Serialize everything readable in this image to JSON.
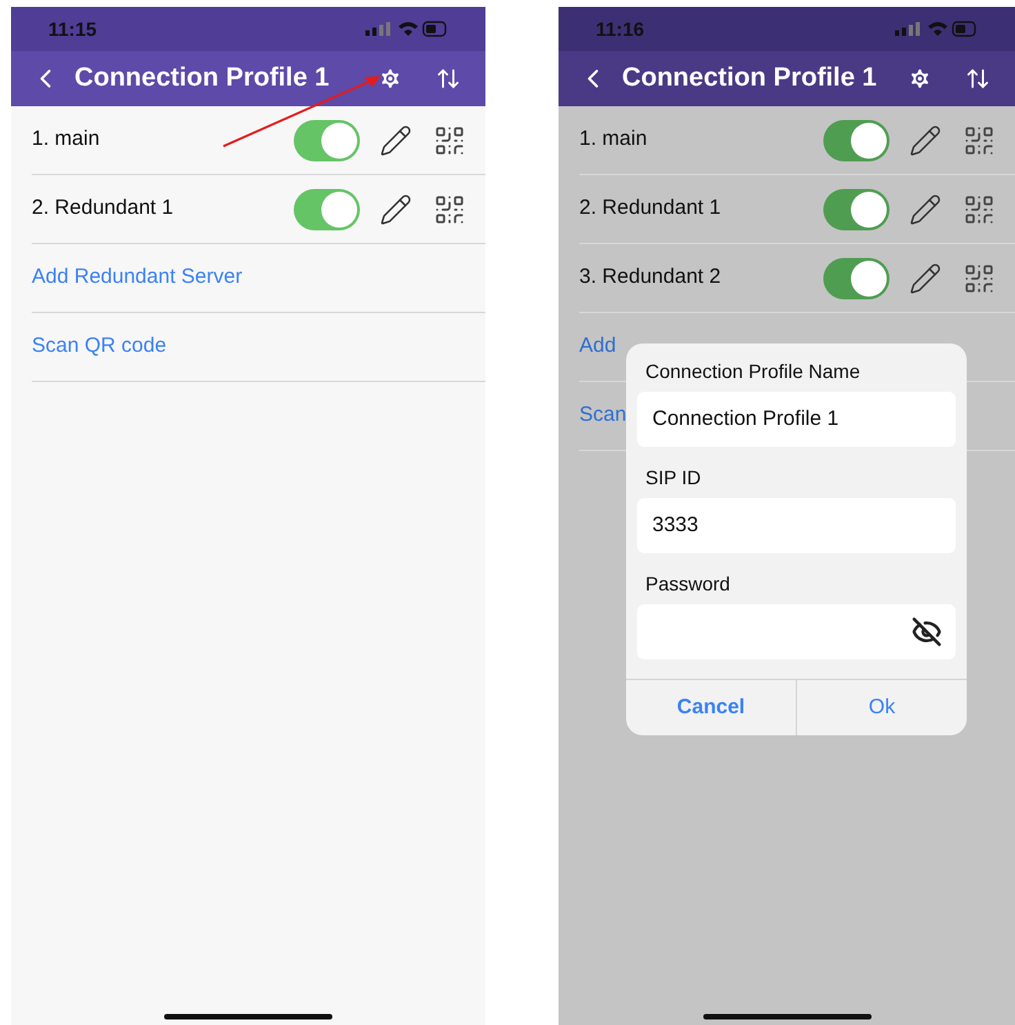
{
  "screens": [
    {
      "time": "11:15",
      "title": "Connection Profile 1",
      "dimmed": false,
      "annotation_arrow": true,
      "servers": [
        {
          "name": "1. main",
          "on": true
        },
        {
          "name": "2. Redundant 1",
          "on": true
        }
      ],
      "links": [
        "Add Redundant Server",
        "Scan QR code"
      ]
    },
    {
      "time": "11:16",
      "title": "Connection Profile 1",
      "dimmed": true,
      "annotation_arrow": false,
      "servers": [
        {
          "name": "1. main",
          "on": true
        },
        {
          "name": "2. Redundant 1",
          "on": true
        },
        {
          "name": "3. Redundant 2",
          "on": true
        }
      ],
      "links": [
        "Add",
        "Scan"
      ],
      "dialog": {
        "fields": [
          {
            "label": "Connection Profile Name",
            "value": "Connection Profile 1",
            "kind": "text"
          },
          {
            "label": "SIP ID",
            "value": "3333",
            "kind": "text"
          },
          {
            "label": "Password",
            "kind": "password"
          }
        ],
        "buttons": [
          "Cancel",
          "Ok"
        ]
      }
    }
  ]
}
